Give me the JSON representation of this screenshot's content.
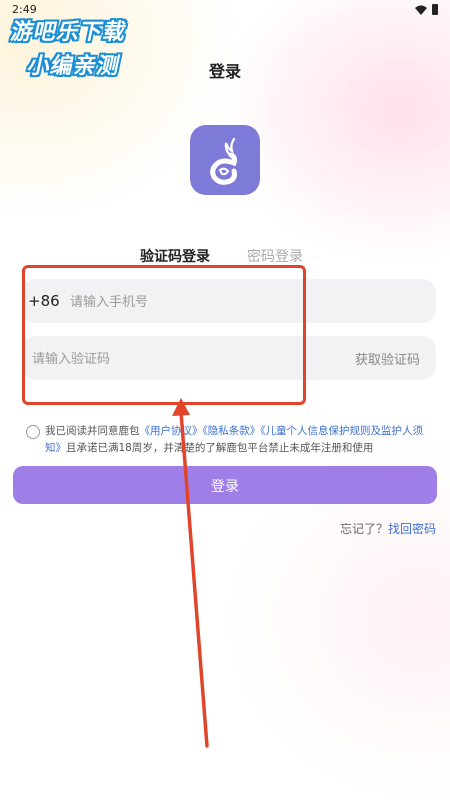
{
  "status_bar": {
    "time": "2:49",
    "icons": [
      "wifi-icon",
      "battery-icon"
    ]
  },
  "watermark": {
    "line1": "游吧乐下载",
    "line2": "小编亲测"
  },
  "header": {
    "title": "登录"
  },
  "logo": {
    "icon": "deer-logo-icon",
    "color": "#7e7ad8"
  },
  "tabs": [
    {
      "label": "验证码登录",
      "active": true
    },
    {
      "label": "密码登录",
      "active": false
    }
  ],
  "form": {
    "country_code": "+86",
    "phone_placeholder": "请输入手机号",
    "code_placeholder": "请输入验证码",
    "get_code_label": "获取验证码"
  },
  "agreement": {
    "prefix": "我已阅读并同意鹿包",
    "link_user": "《用户协议》",
    "link_privacy": "《隐私条款》",
    "link_children": "《儿童个人信息保护规则及监护人须知》",
    "suffix": "且承诺已满18周岁，并清楚的了解鹿包平台禁止未成年注册和使用"
  },
  "login_button": {
    "label": "登录",
    "color": "#a07ee8"
  },
  "forgot": {
    "text": "忘记了？",
    "link": "找回密码"
  },
  "annotation": {
    "color": "#e0442a"
  }
}
